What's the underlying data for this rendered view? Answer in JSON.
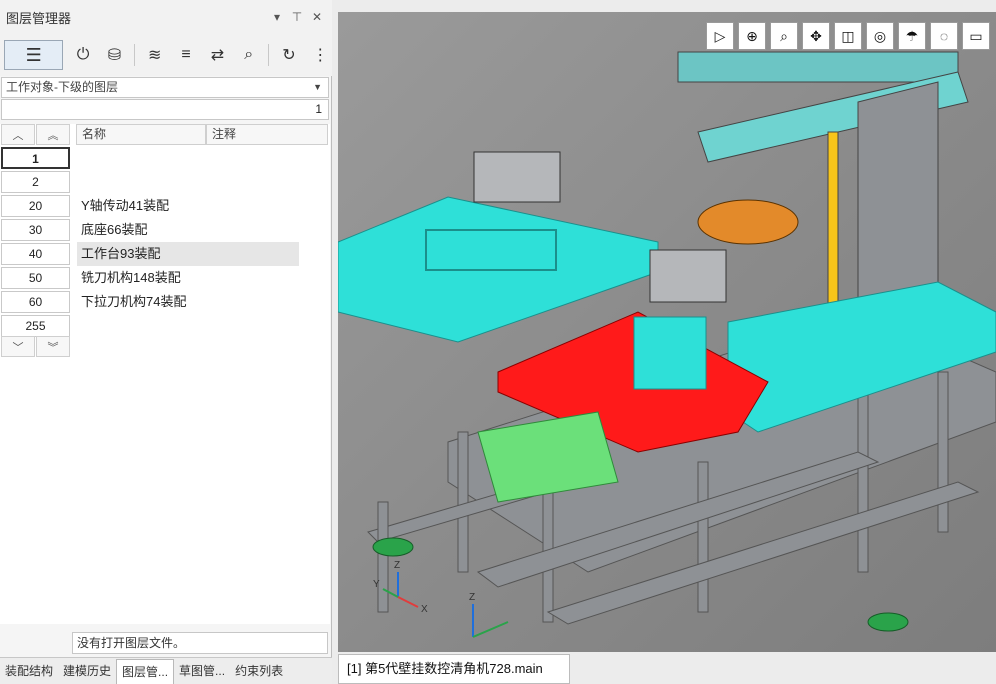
{
  "panel": {
    "title": "图层管理器",
    "controls": {
      "menu": "▾",
      "pin": "⊤",
      "close": "✕"
    },
    "toolbar": [
      "layer-list-icon",
      "power-icon",
      "database-icon",
      "layers-icon",
      "list-icon",
      "sync-icon",
      "search-icon",
      "refresh-icon",
      "more-icon"
    ],
    "dropdown_value": "工作对象-下级的图层",
    "number_field": "1",
    "columns": {
      "name": "名称",
      "note": "注释"
    },
    "rows": [
      {
        "num": "1",
        "name": ""
      },
      {
        "num": "2",
        "name": ""
      },
      {
        "num": "20",
        "name": "Y轴传动41装配"
      },
      {
        "num": "30",
        "name": "底座66装配"
      },
      {
        "num": "40",
        "name": "工作台93装配"
      },
      {
        "num": "50",
        "name": "铣刀机构148装配"
      },
      {
        "num": "60",
        "name": "下拉刀机构74装配"
      },
      {
        "num": "255",
        "name": ""
      }
    ],
    "status": "没有打开图层文件。",
    "tabs": [
      "装配结构",
      "建模历史",
      "图层管...",
      "草图管...",
      "约束列表"
    ]
  },
  "viewport": {
    "tools": [
      "play-icon",
      "zoom-fit-icon",
      "zoom-icon",
      "pan-icon",
      "view-cube-icon",
      "render-mode-icon",
      "light-icon",
      "bulb-icon",
      "display-icon"
    ],
    "doc_tab": "[1] 第5代壁挂数控清角机728.main",
    "axis_labels": {
      "x": "X",
      "y": "Y",
      "z": "Z"
    }
  },
  "colors": {
    "cyan": "#2ee0d8",
    "red": "#ff1a1a",
    "green": "#6be07a",
    "grey_frame": "#8a8d90",
    "orange": "#e38a2a"
  }
}
